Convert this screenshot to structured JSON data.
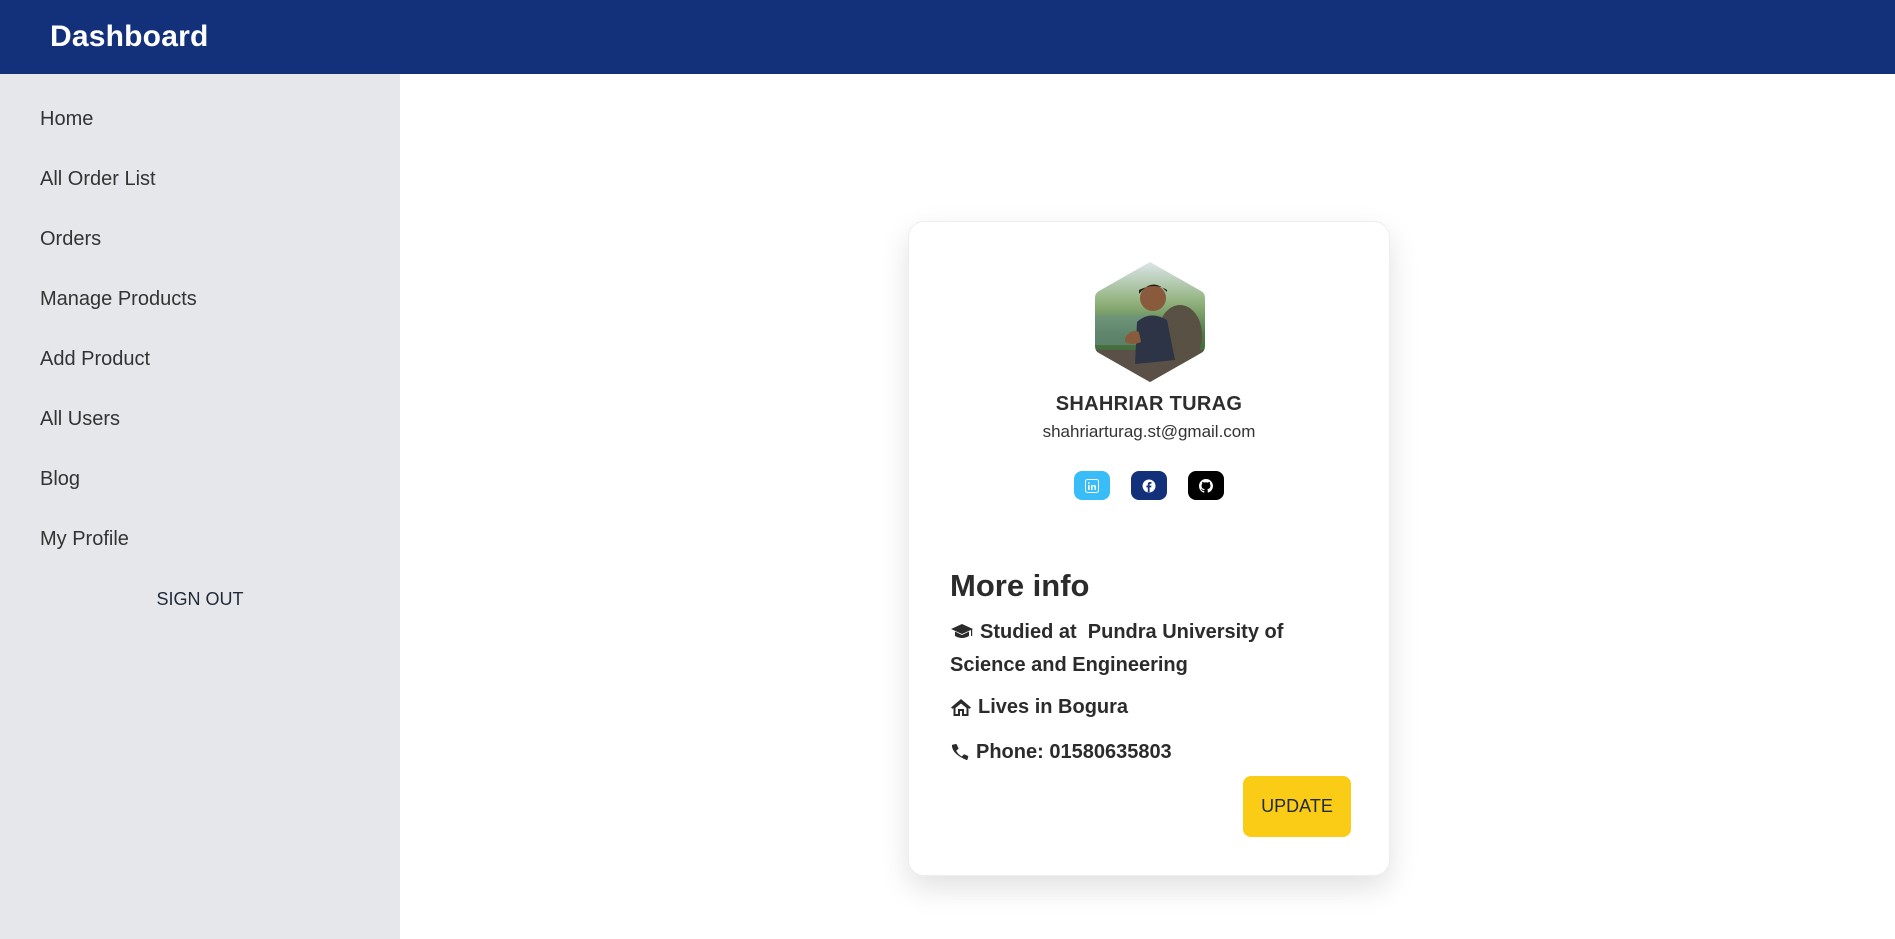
{
  "app": {
    "title": "Dashboard"
  },
  "sidebar": {
    "items": [
      {
        "label": "Home"
      },
      {
        "label": "All Order List"
      },
      {
        "label": "Orders"
      },
      {
        "label": "Manage Products"
      },
      {
        "label": "Add Product"
      },
      {
        "label": "All Users"
      },
      {
        "label": "Blog"
      },
      {
        "label": "My Profile"
      }
    ],
    "signout_label": "SIGN OUT"
  },
  "profile": {
    "name": "SHAHRIAR TURAG",
    "email": "shahriarturag.st@gmail.com",
    "socials": [
      {
        "icon": "linkedin-icon",
        "color": "#38bdf8"
      },
      {
        "icon": "facebook-icon",
        "color": "#13307a"
      },
      {
        "icon": "github-icon",
        "color": "#000000"
      }
    ],
    "more_info_title": "More info",
    "study_text": "Studied at  Pundra University of Science and Engineering",
    "lives_text": "Lives in Bogura",
    "phone_text": "Phone: 01580635803",
    "update_label": "UPDATE"
  },
  "colors": {
    "topbar": "#13307a",
    "sidebar_bg": "#e5e7eb",
    "accent_button": "#facc15"
  }
}
